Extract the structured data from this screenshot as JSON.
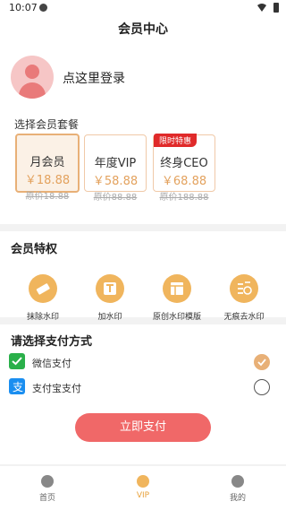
{
  "status_bar": {
    "time": "10:07"
  },
  "header": {
    "title": "会员中心"
  },
  "profile": {
    "login_text": "点这里登录"
  },
  "plans": {
    "title": "选择会员套餐",
    "items": [
      {
        "name": "月会员",
        "price": "￥18.88",
        "original": "原价18.88",
        "badge": ""
      },
      {
        "name": "年度VIP",
        "price": "￥58.88",
        "original": "原价88.88",
        "badge": ""
      },
      {
        "name": "终身CEO",
        "price": "￥68.88",
        "original": "原价188.88",
        "badge": "限时特惠"
      }
    ],
    "selected_index": 0
  },
  "privileges": {
    "title": "会员特权",
    "items": [
      {
        "label": "抹除水印",
        "icon": "eraser-icon"
      },
      {
        "label": "加水印",
        "icon": "text-t-icon"
      },
      {
        "label": "原创水印模版",
        "icon": "template-icon"
      },
      {
        "label": "无痕去水印",
        "icon": "remove-watermark-icon"
      }
    ]
  },
  "payment": {
    "title": "请选择支付方式",
    "methods": [
      {
        "label": "微信支付",
        "icon": "wechat-icon",
        "checked": true
      },
      {
        "label": "支付宝支付",
        "icon": "alipay-icon",
        "checked": false
      }
    ],
    "pay_button": "立即支付"
  },
  "tabbar": {
    "items": [
      {
        "label": "首页",
        "icon": "home-icon",
        "active": false
      },
      {
        "label": "VIP",
        "icon": "vip-crown-icon",
        "active": true
      },
      {
        "label": "我的",
        "icon": "user-icon",
        "active": false
      }
    ]
  },
  "colors": {
    "accent": "#e8b077",
    "pay_button": "#f06868",
    "badge": "#e02a2a",
    "price": "#e3a25e"
  }
}
